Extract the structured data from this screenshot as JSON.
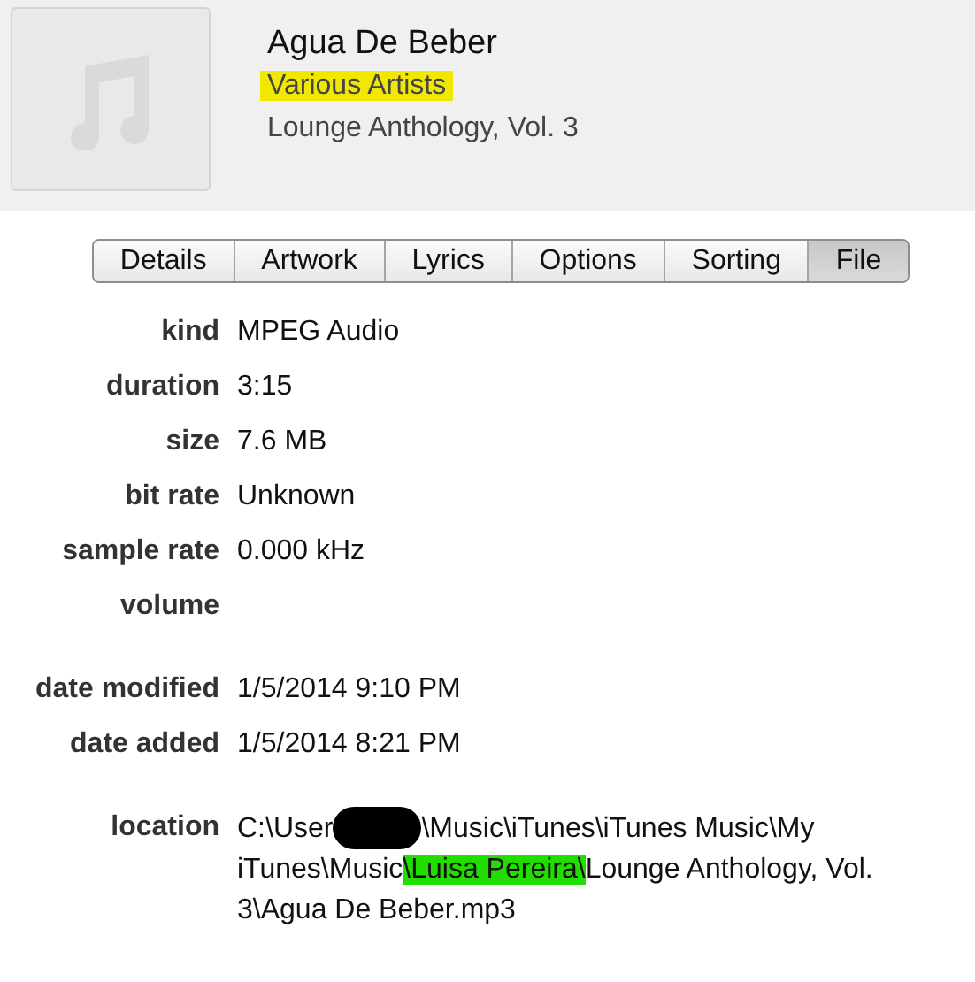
{
  "header": {
    "title": "Agua De Beber",
    "artist": {
      "text": "Various Artists",
      "highlighted": true
    },
    "album": "Lounge Anthology, Vol. 3"
  },
  "tabs": [
    {
      "label": "Details",
      "selected": false
    },
    {
      "label": "Artwork",
      "selected": false
    },
    {
      "label": "Lyrics",
      "selected": false
    },
    {
      "label": "Options",
      "selected": false
    },
    {
      "label": "Sorting",
      "selected": false
    },
    {
      "label": "File",
      "selected": true
    }
  ],
  "groups": [
    [
      {
        "label": "kind",
        "value": "MPEG Audio"
      },
      {
        "label": "duration",
        "value": "3:15"
      },
      {
        "label": "size",
        "value": "7.6 MB"
      },
      {
        "label": "bit rate",
        "value": "Unknown"
      },
      {
        "label": "sample rate",
        "value": "0.000 kHz"
      },
      {
        "label": "volume"
      }
    ],
    [
      {
        "label": "date modified",
        "value": "1/5/2014 9:10 PM"
      },
      {
        "label": "date added",
        "value": "1/5/2014 8:21 PM"
      }
    ],
    [
      {
        "label": "location",
        "segments": [
          {
            "kind": "text",
            "parts": [
              {
                "text": "C:\\User",
                "highlighted": false
              }
            ]
          },
          {
            "kind": "redacted"
          },
          {
            "kind": "text",
            "parts": [
              {
                "text": "\\Music\\iTunes\\iTunes Music\\My",
                "highlighted": false
              }
            ]
          },
          {
            "kind": "text",
            "parts": [
              {
                "text": "iTunes\\Music",
                "highlighted": false
              },
              {
                "text": "\\Luisa Pereira\\",
                "highlighted": true
              },
              {
                "text": "Lounge Anthology, Vol. 3\\Agua De Beber.mp3",
                "highlighted": false
              }
            ]
          }
        ]
      }
    ]
  ]
}
